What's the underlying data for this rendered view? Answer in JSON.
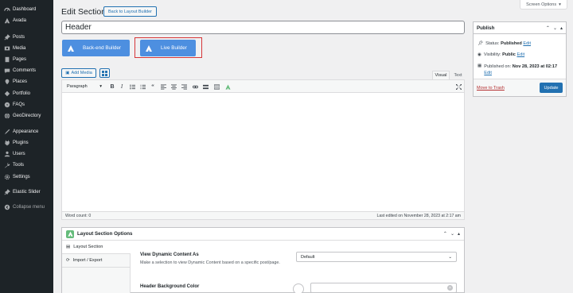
{
  "sidebar": {
    "items": [
      {
        "label": "Dashboard",
        "icon": "dashboard-icon"
      },
      {
        "label": "Avada",
        "icon": "avada-icon"
      },
      {
        "label": "Posts",
        "icon": "pin-icon"
      },
      {
        "label": "Media",
        "icon": "media-icon"
      },
      {
        "label": "Pages",
        "icon": "pages-icon"
      },
      {
        "label": "Comments",
        "icon": "comments-icon"
      },
      {
        "label": "Places",
        "icon": "places-icon"
      },
      {
        "label": "Portfolio",
        "icon": "portfolio-icon"
      },
      {
        "label": "FAQs",
        "icon": "faq-icon"
      },
      {
        "label": "GeoDirectory",
        "icon": "globe-icon"
      },
      {
        "label": "Appearance",
        "icon": "brush-icon"
      },
      {
        "label": "Plugins",
        "icon": "plugin-icon"
      },
      {
        "label": "Users",
        "icon": "users-icon"
      },
      {
        "label": "Tools",
        "icon": "wrench-icon"
      },
      {
        "label": "Settings",
        "icon": "settings-icon"
      },
      {
        "label": "Elastic Slider",
        "icon": "pin-icon"
      },
      {
        "label": "Collapse menu",
        "icon": "collapse-icon"
      }
    ]
  },
  "header": {
    "screen_options": "Screen Options",
    "title": "Edit Section",
    "back_button": "Back to Layout Builder"
  },
  "post_title": "Header",
  "builders": {
    "backend": "Back-end Builder",
    "live": "Live Builder"
  },
  "editor": {
    "add_media": "Add Media",
    "tab_visual": "Visual",
    "tab_text": "Text",
    "format": "Paragraph",
    "word_count": "Word count: 0",
    "last_edited": "Last edited on November 28, 2023 at 2:17 am"
  },
  "publish": {
    "title": "Publish",
    "status_label": "Status:",
    "status_value": "Published",
    "visibility_label": "Visibility:",
    "visibility_value": "Public",
    "published_label": "Published on:",
    "published_value": "Nov 28, 2023 at 02:17",
    "edit": "Edit",
    "trash": "Move to Trash",
    "update": "Update"
  },
  "layout_options": {
    "title": "Layout Section Options",
    "tabs": [
      "Layout Section",
      "Import / Export"
    ],
    "dynamic_label": "View Dynamic Content As",
    "dynamic_desc": "Make a selection to view Dynamic Content based on a specific post/page.",
    "dynamic_value": "Default",
    "bg_label": "Header Background Color"
  },
  "colors": {
    "sidebar": "#1d2327",
    "accent": "#2271b1",
    "builder_button": "#4d8fe0",
    "highlight": "#d63638"
  }
}
